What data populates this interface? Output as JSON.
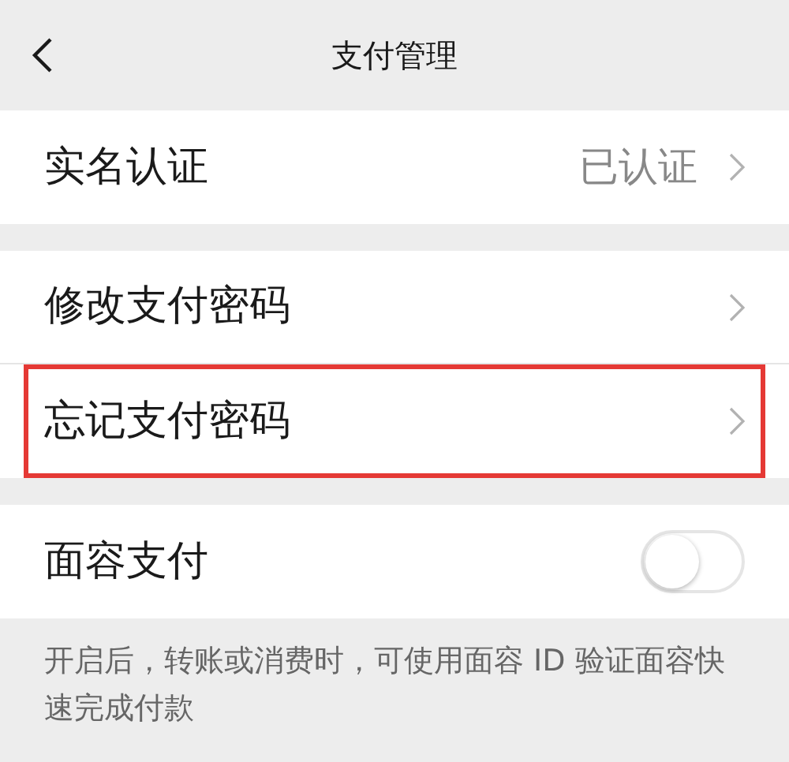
{
  "header": {
    "title": "支付管理"
  },
  "sections": [
    {
      "items": [
        {
          "kind": "nav",
          "label": "实名认证",
          "value": "已认证",
          "highlighted": false
        }
      ]
    },
    {
      "items": [
        {
          "kind": "nav",
          "label": "修改支付密码",
          "highlighted": false
        },
        {
          "kind": "nav",
          "label": "忘记支付密码",
          "highlighted": true
        }
      ]
    },
    {
      "items": [
        {
          "kind": "toggle",
          "label": "面容支付",
          "on": false,
          "highlighted": false
        }
      ]
    }
  ],
  "footer_note": "开启后，转账或消费时，可使用面容 ID 验证面容快速完成付款"
}
